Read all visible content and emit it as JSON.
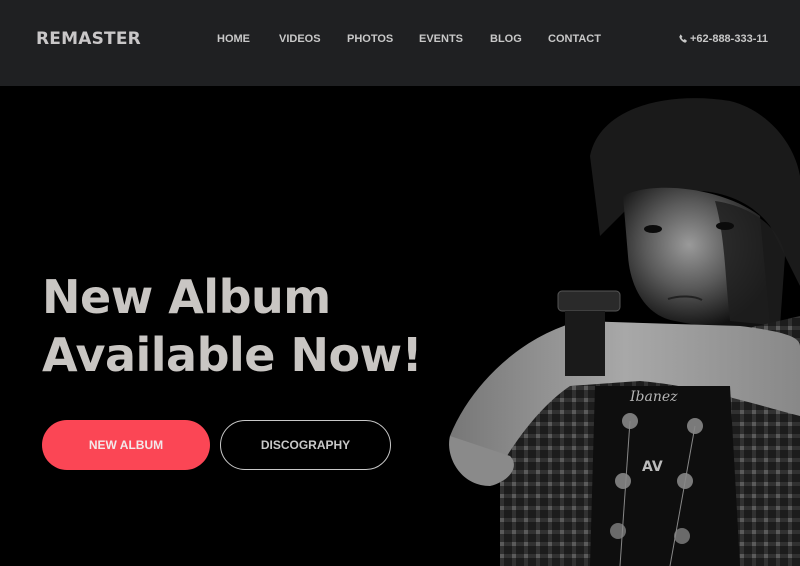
{
  "header": {
    "logo": "REMASTER",
    "nav": [
      {
        "label": "HOME"
      },
      {
        "label": "VIDEOS"
      },
      {
        "label": "PHOTOS"
      },
      {
        "label": "EVENTS"
      },
      {
        "label": "BLOG"
      },
      {
        "label": "CONTACT"
      }
    ],
    "phone": {
      "icon": "phone-icon",
      "number": "+62-888-333-11"
    }
  },
  "hero": {
    "headline_line1": "New Album",
    "headline_line2": "Available Now!",
    "primary_button": "NEW ALBUM",
    "secondary_button": "DISCOGRAPHY",
    "image": "black-and-white portrait of young man resting arm on guitar headstock"
  },
  "colors": {
    "header_bg": "#1f2022",
    "hero_bg": "#000000",
    "accent": "#fb4655",
    "text_light": "#c8c8c8",
    "headline": "#c9c6c3"
  }
}
